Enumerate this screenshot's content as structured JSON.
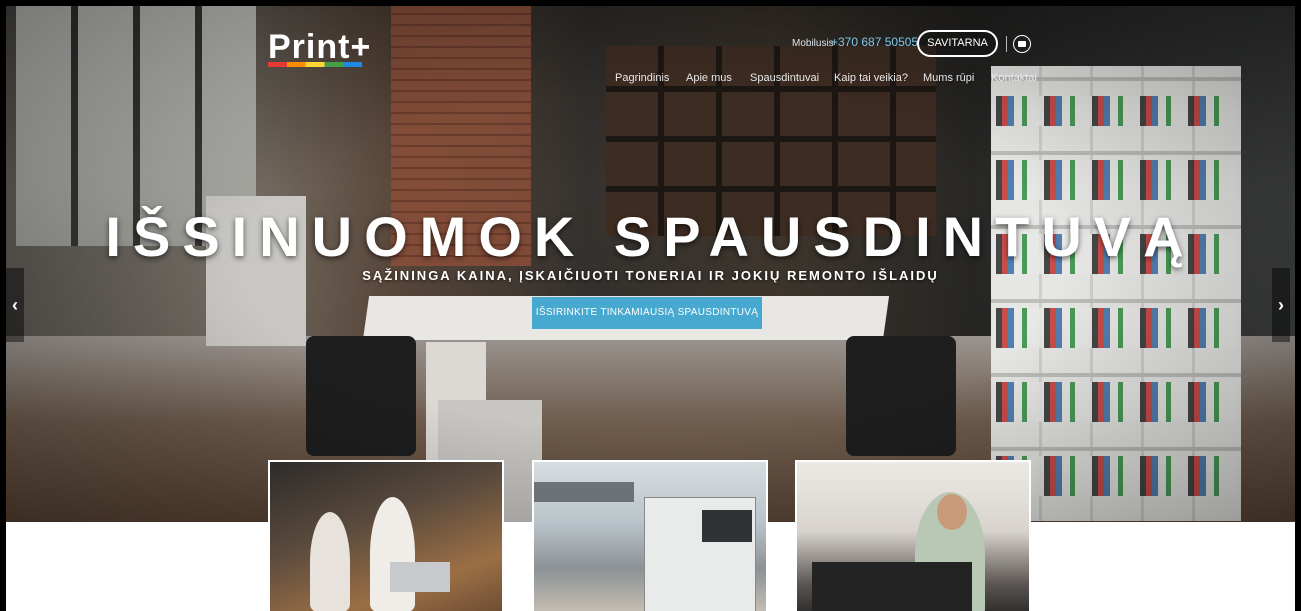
{
  "header": {
    "logo_text": "Print+",
    "mobile_label": "Mobilusis",
    "mobile_number": "+370 687 50505",
    "savitarna_label": "SAVITARNA",
    "mail_icon": "envelope-icon"
  },
  "nav": {
    "items": [
      {
        "label": "Pagrindinis"
      },
      {
        "label": "Apie mus"
      },
      {
        "label": "Spausdintuvai"
      },
      {
        "label": "Kaip tai veikia?"
      },
      {
        "label": "Mums rūpi"
      },
      {
        "label": "Kontaktai"
      }
    ]
  },
  "hero": {
    "headline": "IŠSINUOMOK SPAUSDINTUVĄ",
    "subheadline": "SĄŽININGA KAINA, ĮSKAIČIUOTI TONERIAI IR JOKIŲ REMONTO IŠLAIDŲ",
    "cta_label": "IŠSIRINKITE TINKAMIAUSIĄ SPAUSDINTUVĄ",
    "prev_arrow": "‹",
    "next_arrow": "›"
  },
  "colors": {
    "cta": "#47a9cf",
    "phone": "#7cc7e8"
  }
}
